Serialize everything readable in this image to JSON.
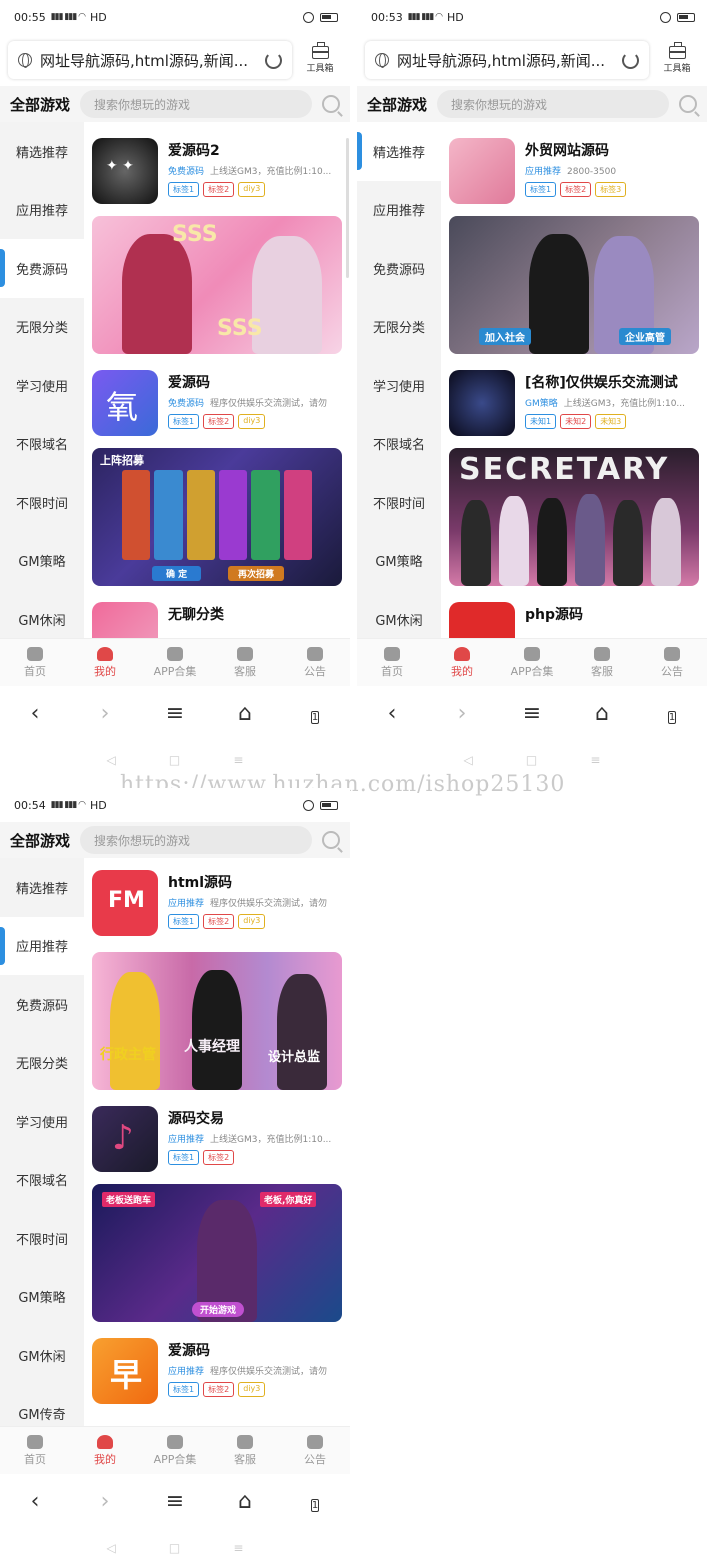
{
  "phones": [
    {
      "status": {
        "time": "00:55",
        "net": "HD"
      },
      "url": "网址导航源码,html源码,新闻...",
      "toolbox": "工具箱",
      "header": {
        "title": "全部游戏",
        "placeholder": "搜索你想玩的游戏"
      },
      "nav": [
        "精选推荐",
        "应用推荐",
        "免费源码",
        "无限分类",
        "学习使用",
        "不限域名",
        "不限时间",
        "GM策略",
        "GM休闲"
      ],
      "active_nav": 2,
      "games": [
        {
          "title": "爱源码2",
          "cat": "免费源码",
          "desc": "上线送GM3，充值比例1:10...",
          "tags": [
            "标签1",
            "标签2",
            "diy3"
          ]
        },
        {
          "title": "爱源码",
          "cat": "免费源码",
          "desc": "程序仅供娱乐交流测试，请勿",
          "tags": [
            "标签1",
            "标签2",
            "diy3"
          ]
        },
        {
          "title": "无聊分类",
          "cat": "",
          "desc": "",
          "tags": []
        }
      ],
      "banners": [
        {
          "text": "SSS"
        },
        {
          "text": "上阵招募",
          "btn1": "确 定",
          "btn2": "再次招募"
        }
      ]
    },
    {
      "status": {
        "time": "00:53",
        "net": "HD"
      },
      "url": "网址导航源码,html源码,新闻...",
      "toolbox": "工具箱",
      "header": {
        "title": "全部游戏",
        "placeholder": "搜索你想玩的游戏"
      },
      "nav": [
        "精选推荐",
        "应用推荐",
        "免费源码",
        "无限分类",
        "学习使用",
        "不限域名",
        "不限时间",
        "GM策略",
        "GM休闲"
      ],
      "active_nav": 0,
      "games": [
        {
          "title": "外贸网站源码",
          "cat": "应用推荐",
          "desc": "2800-3500",
          "tags": [
            "标签1",
            "标签2",
            "标签3"
          ]
        },
        {
          "title": "[名称]仅供娱乐交流测试",
          "cat": "GM策略",
          "desc": "上线送GM3，充值比例1:10...",
          "tags": [
            "未知1",
            "未知2",
            "未知3"
          ]
        },
        {
          "title": "php源码",
          "cat": "",
          "desc": "",
          "tags": []
        }
      ],
      "banners": [
        {
          "text": "加入社会",
          "btn2": "企业高管"
        },
        {
          "text": "SECRETARY"
        }
      ]
    },
    {
      "status": {
        "time": "00:54",
        "net": "HD"
      },
      "header": {
        "title": "全部游戏",
        "placeholder": "搜索你想玩的游戏"
      },
      "nav": [
        "精选推荐",
        "应用推荐",
        "免费源码",
        "无限分类",
        "学习使用",
        "不限域名",
        "不限时间",
        "GM策略",
        "GM休闲",
        "GM传奇"
      ],
      "active_nav": 1,
      "games": [
        {
          "title": "html源码",
          "cat": "应用推荐",
          "desc": "程序仅供娱乐交流测试，请勿",
          "tags": [
            "标签1",
            "标签2",
            "diy3"
          ]
        },
        {
          "title": "源码交易",
          "cat": "应用推荐",
          "desc": "上线送GM3，充值比例1:10...",
          "tags": [
            "标签1",
            "标签2"
          ]
        },
        {
          "title": "爱源码",
          "cat": "应用推荐",
          "desc": "程序仅供娱乐交流测试，请勿",
          "tags": [
            "标签1",
            "标签2",
            "diy3"
          ]
        }
      ],
      "banners": [
        {
          "text": "人事经理",
          "btn1": "行政主管",
          "btn2": "设计总监"
        },
        {
          "text": "开始游戏",
          "btn1": "老板送跑车",
          "btn2": "老板,你真好"
        }
      ]
    }
  ],
  "tabs": [
    "首页",
    "我的",
    "APP合集",
    "客服",
    "公告"
  ],
  "active_tab": 1,
  "watermark": "https://www.huzhan.com/ishop25130",
  "colors": {
    "accent": "#2d8fe0",
    "active_tab": "#e04848"
  }
}
